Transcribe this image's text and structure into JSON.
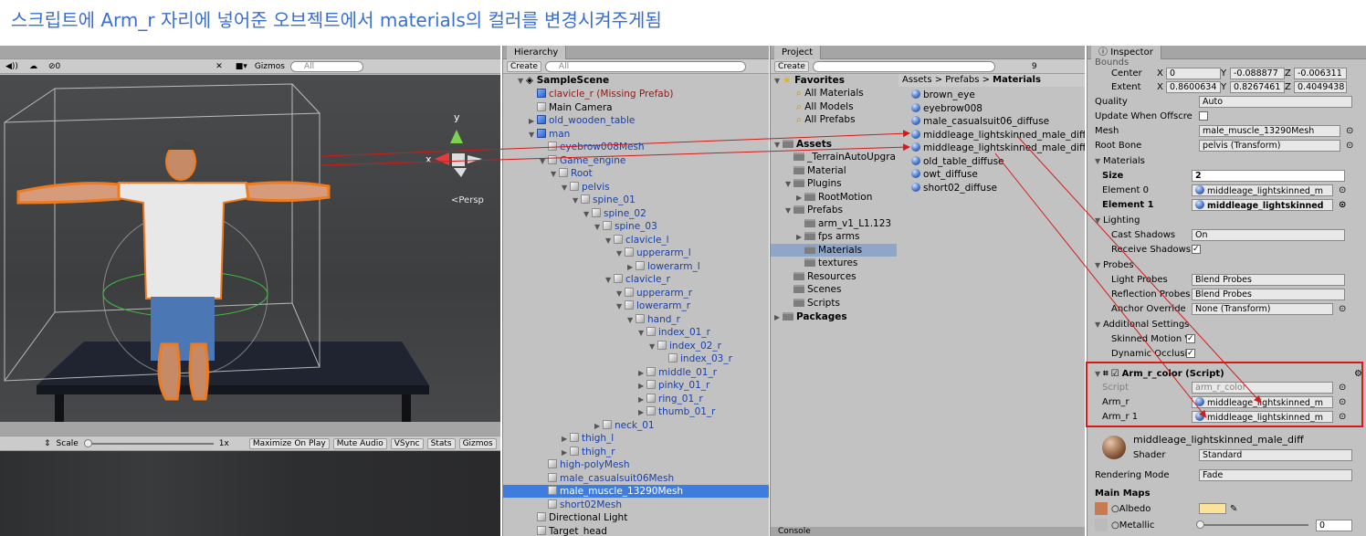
{
  "caption": "스크립트에 Arm_r 자리에 넣어준 오브젝트에서 materials의 컬러를 변경시켜주게됨",
  "scene": {
    "toolbar": {
      "audio": "◀))",
      "fx": "☁",
      "hidden": "⊘0",
      "tools": "✕",
      "camera": "■▾",
      "gizmos": "Gizmos",
      "search_placeholder": "All"
    },
    "persp_label": "<Persp",
    "gizmo_axes": {
      "x": "x",
      "y": "y"
    }
  },
  "game": {
    "aspect": "⇕",
    "scale_label": "Scale",
    "scale_value": "1x",
    "buttons": [
      "Maximize On Play",
      "Mute Audio",
      "VSync",
      "Stats",
      "Gizmos"
    ]
  },
  "hierarchy": {
    "tab": "Hierarchy",
    "create": "Create",
    "search_placeholder": "All",
    "scene_name": "SampleScene",
    "items": [
      {
        "label": "clavicle_r (Missing Prefab)",
        "indent": 1,
        "tri": "",
        "icon": "cube-b",
        "color": "#8b1a1a"
      },
      {
        "label": "Main Camera",
        "indent": 1,
        "tri": "",
        "icon": "cube",
        "color": ""
      },
      {
        "label": "old_wooden_table",
        "indent": 1,
        "tri": "▶",
        "icon": "cube-b",
        "color": "#1a3fa6"
      },
      {
        "label": "man",
        "indent": 1,
        "tri": "▼",
        "icon": "cube-b",
        "color": "#1a3fa6"
      },
      {
        "label": "eyebrow008Mesh",
        "indent": 2,
        "tri": "",
        "icon": "cube",
        "color": "#1a3fa6"
      },
      {
        "label": "Game_engine",
        "indent": 2,
        "tri": "▼",
        "icon": "cube",
        "color": "#1a3fa6"
      },
      {
        "label": "Root",
        "indent": 3,
        "tri": "▼",
        "icon": "cube",
        "color": "#1a3fa6"
      },
      {
        "label": "pelvis",
        "indent": 4,
        "tri": "▼",
        "icon": "cube",
        "color": "#1a3fa6"
      },
      {
        "label": "spine_01",
        "indent": 5,
        "tri": "▼",
        "icon": "cube",
        "color": "#1a3fa6"
      },
      {
        "label": "spine_02",
        "indent": 6,
        "tri": "▼",
        "icon": "cube",
        "color": "#1a3fa6"
      },
      {
        "label": "spine_03",
        "indent": 7,
        "tri": "▼",
        "icon": "cube",
        "color": "#1a3fa6"
      },
      {
        "label": "clavicle_l",
        "indent": 8,
        "tri": "▼",
        "icon": "cube",
        "color": "#1a3fa6"
      },
      {
        "label": "upperarm_l",
        "indent": 9,
        "tri": "▼",
        "icon": "cube",
        "color": "#1a3fa6"
      },
      {
        "label": "lowerarm_l",
        "indent": 10,
        "tri": "▶",
        "icon": "cube",
        "color": "#1a3fa6"
      },
      {
        "label": "clavicle_r",
        "indent": 8,
        "tri": "▼",
        "icon": "cube",
        "color": "#1a3fa6"
      },
      {
        "label": "upperarm_r",
        "indent": 9,
        "tri": "▼",
        "icon": "cube",
        "color": "#1a3fa6"
      },
      {
        "label": "lowerarm_r",
        "indent": 9,
        "tri": "▼",
        "icon": "cube",
        "color": "#1a3fa6"
      },
      {
        "label": "hand_r",
        "indent": 10,
        "tri": "▼",
        "icon": "cube",
        "color": "#1a3fa6"
      },
      {
        "label": "index_01_r",
        "indent": 11,
        "tri": "▼",
        "icon": "cube",
        "color": "#1a3fa6"
      },
      {
        "label": "index_02_r",
        "indent": 12,
        "tri": "▼",
        "icon": "cube",
        "color": "#1a3fa6"
      },
      {
        "label": "index_03_r",
        "indent": 13,
        "tri": "",
        "icon": "cube",
        "color": "#1a3fa6"
      },
      {
        "label": "middle_01_r",
        "indent": 11,
        "tri": "▶",
        "icon": "cube",
        "color": "#1a3fa6"
      },
      {
        "label": "pinky_01_r",
        "indent": 11,
        "tri": "▶",
        "icon": "cube",
        "color": "#1a3fa6"
      },
      {
        "label": "ring_01_r",
        "indent": 11,
        "tri": "▶",
        "icon": "cube",
        "color": "#1a3fa6"
      },
      {
        "label": "thumb_01_r",
        "indent": 11,
        "tri": "▶",
        "icon": "cube",
        "color": "#1a3fa6"
      },
      {
        "label": "neck_01",
        "indent": 7,
        "tri": "▶",
        "icon": "cube",
        "color": "#1a3fa6"
      },
      {
        "label": "thigh_l",
        "indent": 4,
        "tri": "▶",
        "icon": "cube",
        "color": "#1a3fa6"
      },
      {
        "label": "thigh_r",
        "indent": 4,
        "tri": "▶",
        "icon": "cube",
        "color": "#1a3fa6"
      },
      {
        "label": "high-polyMesh",
        "indent": 2,
        "tri": "",
        "icon": "cube",
        "color": "#1a3fa6"
      },
      {
        "label": "male_casualsuit06Mesh",
        "indent": 2,
        "tri": "",
        "icon": "cube",
        "color": "#1a3fa6"
      },
      {
        "label": "male_muscle_13290Mesh",
        "indent": 2,
        "tri": "",
        "icon": "cube",
        "color": "#ffffff",
        "selected": true
      },
      {
        "label": "short02Mesh",
        "indent": 2,
        "tri": "",
        "icon": "cube",
        "color": "#1a3fa6"
      },
      {
        "label": "Directional Light",
        "indent": 1,
        "tri": "",
        "icon": "cube",
        "color": ""
      },
      {
        "label": "Target_head",
        "indent": 1,
        "tri": "",
        "icon": "cube",
        "color": ""
      }
    ]
  },
  "project": {
    "tab": "Project",
    "create": "Create",
    "count": "9",
    "favorites_title": "Favorites",
    "favorites": [
      "All Materials",
      "All Models",
      "All Prefabs"
    ],
    "assets_title": "Assets",
    "folders": [
      {
        "label": "_TerrainAutoUpgra",
        "indent": 1,
        "tri": ""
      },
      {
        "label": "Material",
        "indent": 1,
        "tri": ""
      },
      {
        "label": "Plugins",
        "indent": 1,
        "tri": "▼"
      },
      {
        "label": "RootMotion",
        "indent": 2,
        "tri": "▶"
      },
      {
        "label": "Prefabs",
        "indent": 1,
        "tri": "▼"
      },
      {
        "label": "arm_v1_L1.123",
        "indent": 2,
        "tri": ""
      },
      {
        "label": "fps arms",
        "indent": 2,
        "tri": "▶"
      },
      {
        "label": "Materials",
        "indent": 2,
        "tri": "",
        "selected": true
      },
      {
        "label": "textures",
        "indent": 2,
        "tri": ""
      },
      {
        "label": "Resources",
        "indent": 1,
        "tri": ""
      },
      {
        "label": "Scenes",
        "indent": 1,
        "tri": ""
      },
      {
        "label": "Scripts",
        "indent": 1,
        "tri": ""
      }
    ],
    "packages_title": "Packages",
    "breadcrumb": [
      "Assets",
      "Prefabs",
      "Materials"
    ],
    "files": [
      "brown_eye",
      "eyebrow008",
      "male_casualsuit06_diffuse",
      "middleage_lightskinned_male_diff",
      "middleage_lightskinned_male_diff",
      "old_table_diffuse",
      "owt_diffuse",
      "short02_diffuse"
    ],
    "console_tab": "Console"
  },
  "inspector": {
    "tab": "Inspector",
    "bounds_label": "Bounds",
    "center": {
      "label": "Center",
      "x": "0",
      "y": "-0.088877",
      "z": "-0.006311"
    },
    "extent": {
      "label": "Extent",
      "x": "0.8600634",
      "y": "0.8267461",
      "z": "0.4049438"
    },
    "quality": {
      "label": "Quality",
      "value": "Auto"
    },
    "update_offscreen": "Update When Offscre",
    "mesh": {
      "label": "Mesh",
      "value": "male_muscle_13290Mesh"
    },
    "root_bone": {
      "label": "Root Bone",
      "value": "pelvis (Transform)"
    },
    "materials": {
      "title": "Materials",
      "size_label": "Size",
      "size": "2",
      "element0_label": "Element 0",
      "element0": "middleage_lightskinned_m",
      "element1_label": "Element 1",
      "element1": "middleage_lightskinned"
    },
    "lighting": {
      "title": "Lighting",
      "cast_label": "Cast Shadows",
      "cast": "On",
      "receive_label": "Receive Shadows"
    },
    "probes": {
      "title": "Probes",
      "light_label": "Light Probes",
      "light": "Blend Probes",
      "refl_label": "Reflection Probes",
      "refl": "Blend Probes",
      "anchor_label": "Anchor Override",
      "anchor": "None (Transform)"
    },
    "additional": {
      "title": "Additional Settings",
      "motion_label": "Skinned Motion Ve",
      "dynamic_label": "Dynamic Occlusio"
    },
    "script_component": {
      "title": "Arm_r_color (Script)",
      "script_label": "Script",
      "script": "arm_r_color",
      "arm_label": "Arm_r",
      "arm": "middleage_lightskinned_m",
      "arm1_label": "Arm_r 1",
      "arm1": "middleage_lightskinned_m"
    },
    "material_header": {
      "name": "middleage_lightskinned_male_diff",
      "shader_label": "Shader",
      "shader": "Standard"
    },
    "rendering_mode": {
      "label": "Rendering Mode",
      "value": "Fade"
    },
    "main_maps": "Main Maps",
    "albedo": "Albedo",
    "metallic": "Metallic",
    "metallic_value": "0",
    "albedo_color": "#fbe39a"
  },
  "colors": {
    "accent": "#3e7ce0",
    "annotation": "#d51a1a",
    "caption": "#3a6fd0"
  }
}
